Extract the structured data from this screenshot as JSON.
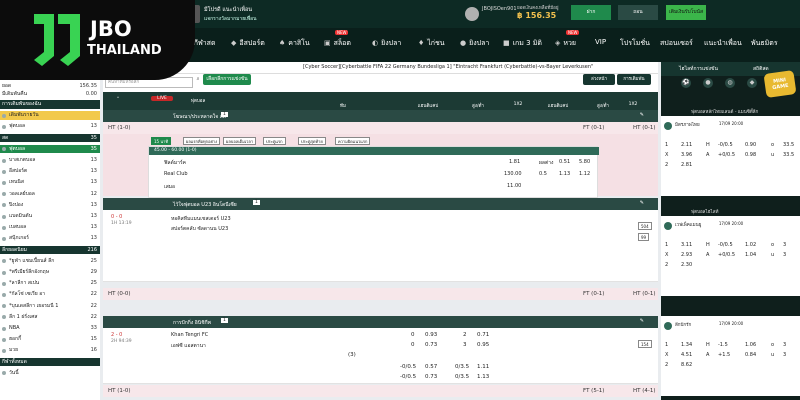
{
  "brand": {
    "name": "JBO",
    "sub": "THAILAND"
  },
  "topbar": {
    "promo_line1": "มีโปรดี แนะนำเพื่อน",
    "promo_line2": "แจกรางวัลมากมายเพื่อน",
    "user": "JBOJISOen901",
    "balance_label": "ยอดเงินคงเหลือที่มีอยู่",
    "balance": "฿ 156.35",
    "deposit": "ฝาก",
    "withdraw": "ถอน",
    "vip_button": "เติมเงินรับโบนัส"
  },
  "nav": {
    "items": [
      "กีฬาสด",
      "อีสปอร์ต",
      "คาสิโน",
      "สล็อต",
      "ยิงปลา",
      "ไก่ชน",
      "ยิงปลา",
      "เกม 3 มิติ",
      "หวย",
      "VIP",
      "โปรโมชั่น",
      "สปอนเซอร์",
      "แนะนำเพื่อน",
      "พันธมิตร"
    ]
  },
  "left": {
    "balance_label": "ยอด",
    "balance": "156.35",
    "credit_label": "มีเดิมพันคืน",
    "credit": "0.00",
    "rows": [
      {
        "label": "การเดิมพันของฉัน",
        "count": "",
        "type": "sec"
      },
      {
        "label": "เดิมพันรายวัน",
        "count": "",
        "type": "hl"
      },
      {
        "label": "ฟุตบอล",
        "count": "13",
        "type": ""
      },
      {
        "label": "สด",
        "count": "35",
        "type": "sec"
      },
      {
        "label": "ฟุตบอล",
        "count": "35",
        "type": "act"
      },
      {
        "label": "บาสเกตบอล",
        "count": "13",
        "type": ""
      },
      {
        "label": "อีสปอร์ต",
        "count": "13",
        "type": ""
      },
      {
        "label": "เทนนิส",
        "count": "13",
        "type": ""
      },
      {
        "label": "วอลเลย์บอล",
        "count": "12",
        "type": ""
      },
      {
        "label": "ปิงปอง",
        "count": "13",
        "type": ""
      },
      {
        "label": "แบดมินตัน",
        "count": "13",
        "type": ""
      },
      {
        "label": "เบสบอล",
        "count": "13",
        "type": ""
      },
      {
        "label": "สนุ๊กเกอร์",
        "count": "13",
        "type": ""
      },
      {
        "label": "ลีกยอดนิยม",
        "count": "216",
        "type": "sec"
      },
      {
        "label": "*ยูฟ่า แชมเปี้ยนส์ ลีก",
        "count": "25",
        "type": ""
      },
      {
        "label": "*พรีเมียร์ลีกอังกฤษ",
        "count": "29",
        "type": ""
      },
      {
        "label": "*ลาลีกา สเปน",
        "count": "25",
        "type": ""
      },
      {
        "label": "*กัลโช่ เซเรีย อา",
        "count": "22",
        "type": ""
      },
      {
        "label": "*บุนเดสลีกา เยอรมนี 1",
        "count": "22",
        "type": ""
      },
      {
        "label": "ลีก 1 ฝรั่งเศส",
        "count": "22",
        "type": ""
      },
      {
        "label": "NBA",
        "count": "33",
        "type": ""
      },
      {
        "label": "ฮอกกี้",
        "count": "15",
        "type": ""
      },
      {
        "label": "มวย",
        "count": "16",
        "type": ""
      },
      {
        "label": "กีฬาทั้งหมด",
        "count": "",
        "type": "sec"
      },
      {
        "label": "วันนี้",
        "count": "",
        "type": ""
      }
    ]
  },
  "center": {
    "top_title": "[Cyber Soccer][Cyberbattle FIFA 22 Germany Bundesliga 1] \"Eintracht Frankfurt (Cyberbattle)-vs-Bayer Leverkusen\"",
    "search_placeholder": "ค้นหาทีมหรือลีก",
    "select_btn": "เลือกลีกการแข่งขัน",
    "sort_btn": "ล่วงหน้า",
    "odds_btn": "การเดิมพัน",
    "header_tab": "ฟุตบอล",
    "header_cols": [
      "ทีม",
      "แฮนดิแคป",
      "สูง/ต่ำ",
      "1X2",
      "แฮนดิแคป",
      "สูง/ต่ำ",
      "1X2"
    ],
    "leagues": [
      {
        "name": "โฆษณา/ประหลาดใจ สด",
        "count": "1",
        "ht_left": "HT (1-0)",
        "ht_mid": "FT (0-1)",
        "ht_right": "HT (0-1)"
      },
      {
        "name": "ไว้ใจฟุตบอล U23 อินโดนีเซีย",
        "count": "1",
        "ht_left": "HT (0-0)",
        "ht_mid": "FT (0-1)",
        "ht_right": "HT (0-1)"
      },
      {
        "name": "การปักกิ่ง อินิชิกีพ",
        "count": "1",
        "ht_left": "HT (1-0)",
        "ht_mid": "FT (5-1)",
        "ht_right": "HT (4-1)"
      }
    ],
    "chips": [
      "15 นาที",
      "ผลแรกคือทุกอย่าง",
      "ผลบอลเต็มเวลา",
      "ประตูแรก",
      "ประตูสุดท้าย",
      "ความผิดแนวแรก"
    ],
    "card_head": "45.00 - 60.00 (1-0)",
    "card_rows": [
      {
        "team": "ฟิลด์มาร์ค",
        "v": [
          "1.81",
          "ผลต่าง",
          "0.51",
          "1.5",
          "5.80"
        ]
      },
      {
        "team": "Real Club",
        "v": [
          "130.00",
          "0.5",
          "1.13",
          "1.5",
          "1.12"
        ]
      },
      {
        "team": "เสมอ",
        "v": [
          "11.00",
          "",
          "",
          "",
          ""
        ]
      }
    ],
    "match1": {
      "time": "0 - 0",
      "clock": "1H 13:19",
      "home": "หอคิสทีมแมนเชสเตอร์ U23",
      "away": "สปอร์ตคลับ ซัลดานน U23",
      "side1": "504",
      "side2": "99"
    },
    "match2": {
      "time": "2 - 0",
      "clock": "2H 94:39",
      "home": "Khan Tengri FC",
      "away": "เอฟซี แอสตานา",
      "v1": [
        "0",
        "0.93",
        "0",
        "2",
        "0.71"
      ],
      "v2": [
        "0",
        "0.73",
        "0",
        "3",
        "0.95"
      ],
      "x": "(3)",
      "side": "154",
      "odds_a": [
        "-0/0.5",
        "0.57",
        "0/3.5",
        "1.11"
      ],
      "odds_b": [
        "-0/0.5",
        "0.73",
        "0/3.5",
        "1.13"
      ]
    }
  },
  "right": {
    "tab1": "ไฮไลท์การแข่งขัน",
    "tab2": "สถิติสด",
    "mini": "MINI GAME",
    "matches": [
      {
        "home": "มิตรภาพไทย",
        "mid": "17/09 20:00",
        "away": "",
        "label": "ฟุตบอลหลักไทยแลนด์ - แมนซิตี้ลีก",
        "rows": [
          [
            "1",
            "2.11",
            "H",
            "-0/0.5",
            "0.90",
            "o",
            "33.5"
          ],
          [
            "X",
            "3.96",
            "A",
            "+0/0.5",
            "0.98",
            "u",
            "33.5"
          ],
          [
            "2",
            "2.81",
            "",
            "",
            "",
            "",
            ""
          ]
        ]
      },
      {
        "home": "เวฟเพ็คแมนยู",
        "mid": "17/09 20:00",
        "away": "",
        "label": "ฟุตบอลไฮไลท์",
        "rows": [
          [
            "1",
            "3.11",
            "H",
            "-0/0.5",
            "1.02",
            "o",
            "3"
          ],
          [
            "X",
            "2.93",
            "A",
            "+0/0.5",
            "1.04",
            "u",
            "3"
          ],
          [
            "2",
            "2.30",
            "",
            "",
            "",
            "",
            ""
          ]
        ]
      },
      {
        "home": "ลีกปักรัก",
        "mid": "17/09 20:00",
        "away": "",
        "label": "",
        "rows": [
          [
            "1",
            "1.34",
            "H",
            "-1.5",
            "1.06",
            "o",
            "3"
          ],
          [
            "X",
            "4.51",
            "A",
            "+1.5",
            "0.84",
            "u",
            "3"
          ],
          [
            "2",
            "8.62",
            "",
            "",
            "",
            "",
            ""
          ]
        ]
      }
    ]
  }
}
